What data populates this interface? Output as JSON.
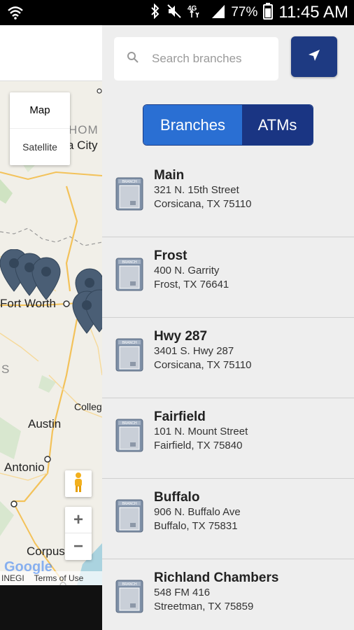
{
  "status_bar": {
    "battery_percent": "77%",
    "time": "11:45 AM",
    "network": "4G"
  },
  "map": {
    "map_type_selected": "Map",
    "map_type_other": "Satellite",
    "labels": {
      "oklahoma": "HOM",
      "city": "a City",
      "fort_worth": "Fort Worth",
      "college": "Colleg",
      "austin": "Austin",
      "antonio": "Antonio",
      "corpus": "Corpus",
      "s_fragment": "S"
    },
    "footer": {
      "inegi": "INEGI",
      "terms": "Terms of Use"
    }
  },
  "search": {
    "placeholder": "Search branches",
    "value": ""
  },
  "tabs": {
    "branches": "Branches",
    "atms": "ATMs"
  },
  "branches": [
    {
      "name": "Main",
      "street": "321 N. 15th Street",
      "city": "Corsicana, TX 75110"
    },
    {
      "name": "Frost",
      "street": "400 N. Garrity",
      "city": "Frost, TX 76641"
    },
    {
      "name": "Hwy 287",
      "street": "3401 S. Hwy 287",
      "city": "Corsicana, TX 75110"
    },
    {
      "name": "Fairfield",
      "street": "101 N. Mount Street",
      "city": "Fairfield, TX 75840"
    },
    {
      "name": "Buffalo",
      "street": "906 N. Buffalo Ave",
      "city": "Buffalo, TX 75831"
    },
    {
      "name": "Richland Chambers",
      "street": "548 FM 416",
      "city": "Streetman, TX 75859"
    }
  ],
  "colors": {
    "tab_active": "#2a6fd3",
    "tab_inactive": "#1a3583",
    "locate_button": "#1e3a82",
    "map_marker": "#4a5e75"
  }
}
